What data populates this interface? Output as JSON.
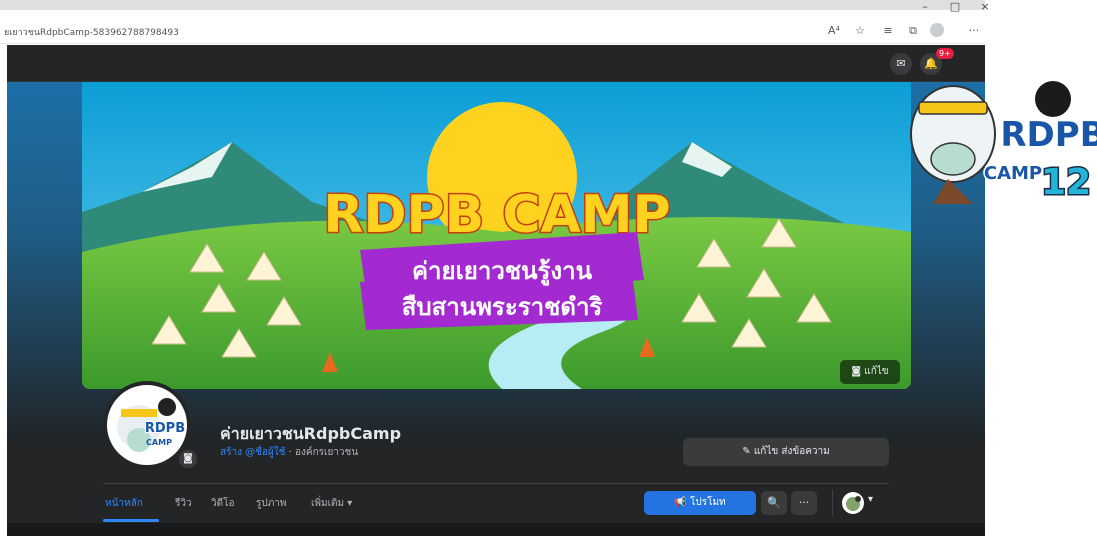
{
  "browser": {
    "url": "ยเยาวชนRdpbCamp-583962788798493",
    "window_controls": [
      "–",
      "□",
      "×"
    ],
    "toolbar_icons": [
      "read-aloud-icon",
      "favorite-add-icon",
      "favorites-icon",
      "collections-icon",
      "profile-icon",
      "more-icon"
    ],
    "read_aloud_glyph": "A⁴",
    "more_glyph": "···"
  },
  "fb_nav": {
    "notification_count": "9+",
    "messenger_glyph": "✉",
    "bell_glyph": "🔔"
  },
  "cover": {
    "headline": "RDPB CAMP",
    "banner_line1": "ค่ายเยาวชนรู้งาน",
    "banner_line2": "สืบสานพระราชดำริ",
    "edit_label": "แก้ไข"
  },
  "page": {
    "name": "ค่ายเยาวชนRdpbCamp",
    "sub_link": "สร้าง @ชื่อผู้ใช้",
    "sub_category": " · องค์กรเยาวชน",
    "edit_message_label": "✎ แก้ไข ส่งข้อความ"
  },
  "tabs": [
    {
      "label": "หน้าหลัก",
      "active": true
    },
    {
      "label": "รีวิว",
      "active": false
    },
    {
      "label": "วิดีโอ",
      "active": false
    },
    {
      "label": "รูปภาพ",
      "active": false
    },
    {
      "label": "เพิ่มเติม ▾",
      "active": false
    }
  ],
  "actions": {
    "promote_label": "📢 โปรโมท",
    "search_glyph": "🔍",
    "more_glyph": "···",
    "caret": "▾"
  },
  "mascot": {
    "line1": "RDPB",
    "line2": "CAMP",
    "number": "12"
  },
  "colors": {
    "fb_dark": "#242526",
    "accent_blue": "#2d88ff",
    "promote_blue": "#2374e1",
    "banner_purple": "#a22ad0",
    "banner_yellow": "#ffd21f"
  }
}
